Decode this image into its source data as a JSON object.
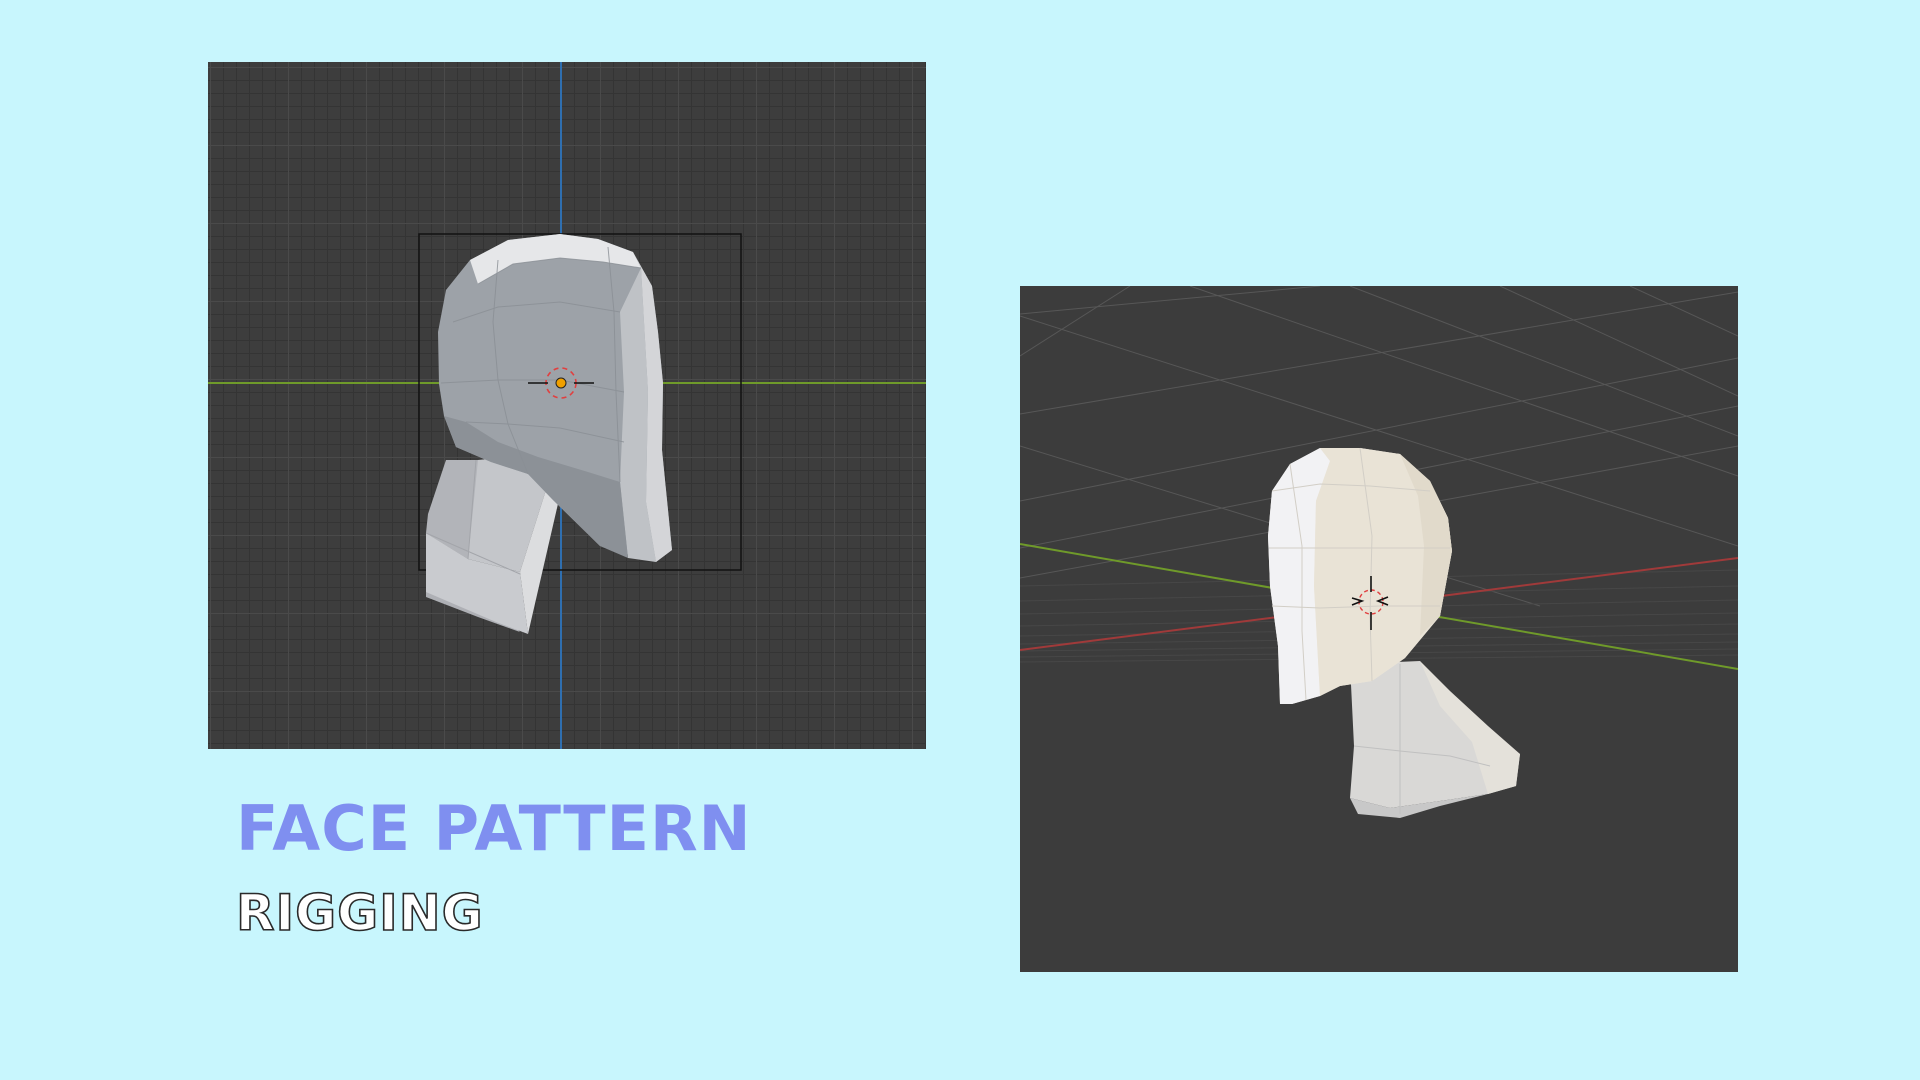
{
  "heading": {
    "title": "FACE PATTERN",
    "subtitle": "RIGGING"
  },
  "viewports": {
    "front": {
      "view": "orthographic side view",
      "model": "low-poly head"
    },
    "perspective": {
      "view": "perspective view",
      "model": "low-poly head"
    }
  },
  "colors": {
    "background": "#c8f6fd",
    "viewport_bg": "#3d3d3d",
    "title": "#7f8ff0",
    "axis_x": "#a03a3a",
    "axis_y": "#6f9a2a",
    "axis_z": "#2f6fb0",
    "origin": "#f0a000",
    "cursor_ring": "#e04040"
  },
  "icons": [
    "3d-cursor-icon",
    "origin-point-icon"
  ]
}
